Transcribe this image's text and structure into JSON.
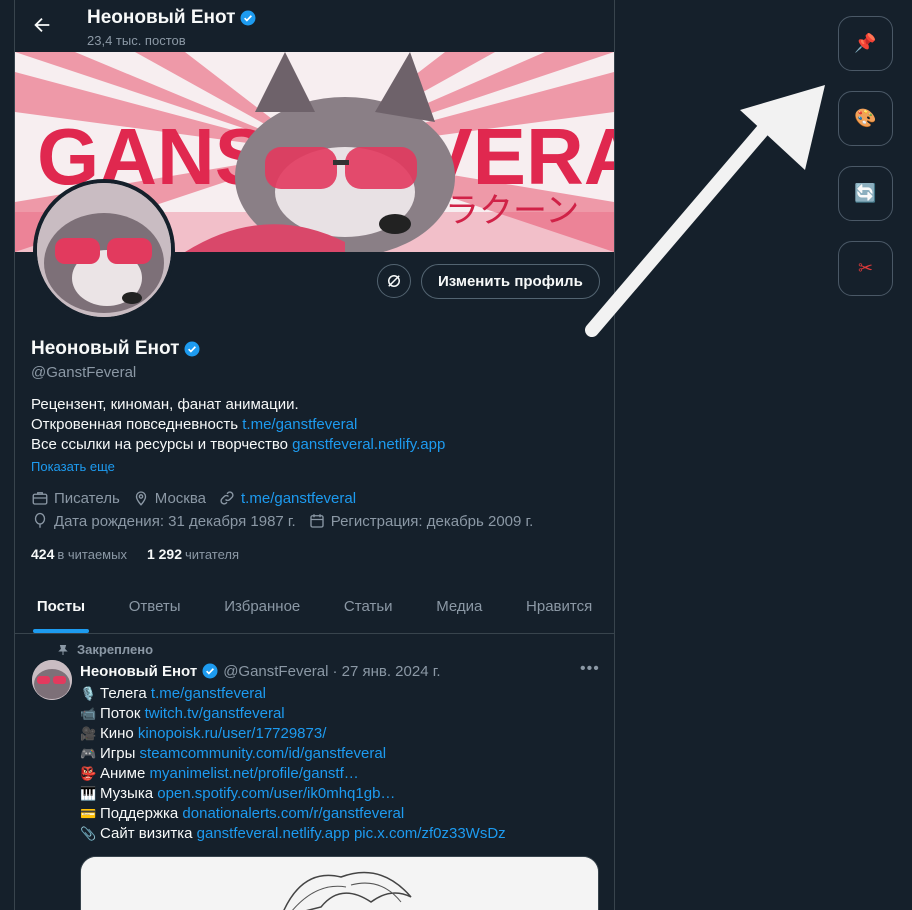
{
  "header": {
    "name": "Неоновый Енот",
    "posts_count": "23,4 тыс. постов"
  },
  "banner": {
    "text": "GANSTFEVERAL",
    "subtext": "ラクーン"
  },
  "profile": {
    "name": "Неоновый Енот",
    "handle": "@GanstFeveral",
    "edit_button": "Изменить профиль",
    "bio_line1": "Рецензент, киноман, фанат анимации.",
    "bio_line2_text": "Откровенная повседневность ",
    "bio_line2_link": "t.me/ganstfeveral",
    "bio_line3_text": "Все ссылки на ресурсы и творчество ",
    "bio_line3_link": "ganstfeveral.netlify.app",
    "show_more": "Показать еще",
    "job": "Писатель",
    "location": "Москва",
    "website": "t.me/ganstfeveral",
    "birthday": "Дата рождения: 31 декабря 1987 г.",
    "joined": "Регистрация: декабрь 2009 г.",
    "following_count": "424",
    "following_label": "в читаемых",
    "followers_count": "1 292",
    "followers_label": "читателя"
  },
  "tabs": [
    "Посты",
    "Ответы",
    "Избранное",
    "Статьи",
    "Медиа",
    "Нравится"
  ],
  "post": {
    "pinned_label": "Закреплено",
    "author": "Неоновый Енот",
    "handle": "@GanstFeveral",
    "date": "· 27 янв. 2024 г.",
    "lines": [
      {
        "icon": "🎙️",
        "label": "Телега ",
        "link": "t.me/ganstfeveral"
      },
      {
        "icon": "📹",
        "label": "Поток ",
        "link": "twitch.tv/ganstfeveral"
      },
      {
        "icon": "🎥",
        "label": "Кино ",
        "link": "kinopoisk.ru/user/17729873/"
      },
      {
        "icon": "🎮",
        "label": "Игры ",
        "link": "steamcommunity.com/id/ganstfeveral"
      },
      {
        "icon": "👺",
        "label": "Аниме ",
        "link": "myanimelist.net/profile/ganstf…"
      },
      {
        "icon": "🎹",
        "label": "Музыка ",
        "link": "open.spotify.com/user/ik0mhq1gb…"
      },
      {
        "icon": "💳",
        "label": "Поддержка ",
        "link": "donationalerts.com/r/ganstfeveral"
      },
      {
        "icon": "📎",
        "label": "Сайт визитка ",
        "link": "ganstfeveral.netlify.app pic.x.com/zf0z33WsDz"
      }
    ]
  },
  "side_tools": [
    {
      "icon": "pushpin-icon",
      "glyph": "📌"
    },
    {
      "icon": "palette-icon",
      "glyph": "🎨"
    },
    {
      "icon": "refresh-icon",
      "glyph": "🔄"
    },
    {
      "icon": "scissors-icon",
      "glyph": "✂"
    }
  ],
  "colors": {
    "background": "#15202b",
    "accent": "#1d9bf0",
    "muted": "#8b98a5",
    "border": "#38444d"
  }
}
